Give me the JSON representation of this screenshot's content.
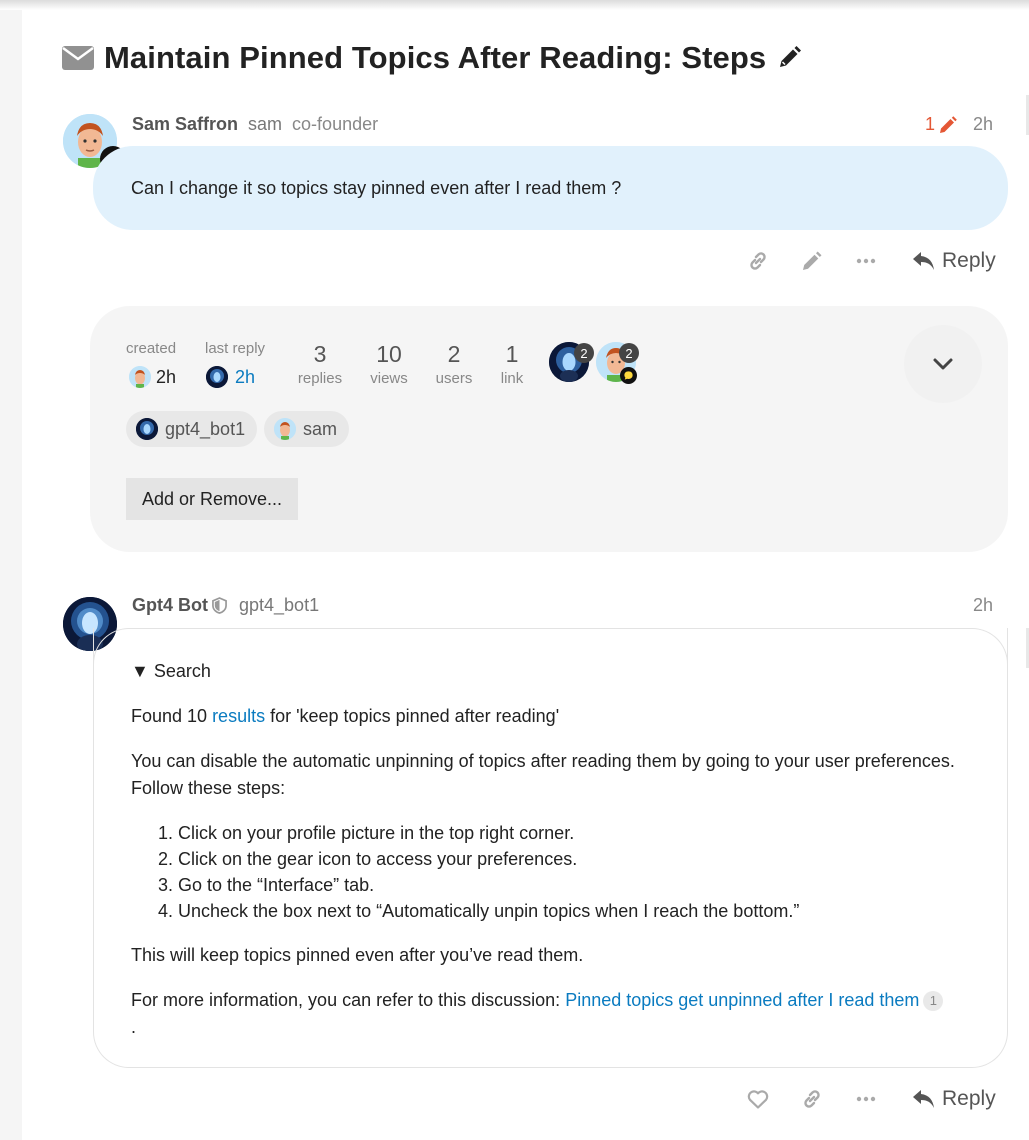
{
  "topic": {
    "title": "Maintain Pinned Topics After Reading: Steps"
  },
  "post1": {
    "full_name": "Sam Saffron",
    "username": "sam",
    "user_title": "co-founder",
    "edit_count": "1",
    "age": "2h",
    "body": "Can I change it so topics stay pinned even after I read them ?",
    "reply_label": "Reply"
  },
  "summary": {
    "created_label": "created",
    "created_value": "2h",
    "last_reply_label": "last reply",
    "last_reply_value": "2h",
    "stats": [
      {
        "num": "3",
        "label": "replies"
      },
      {
        "num": "10",
        "label": "views"
      },
      {
        "num": "2",
        "label": "users"
      },
      {
        "num": "1",
        "label": "link"
      }
    ],
    "participants": [
      {
        "user": "gpt4_bot1",
        "count": "2"
      },
      {
        "user": "sam",
        "count": "2"
      }
    ],
    "chips": [
      "gpt4_bot1",
      "sam"
    ],
    "add_remove_label": "Add or Remove..."
  },
  "post2": {
    "full_name": "Gpt4 Bot",
    "username": "gpt4_bot1",
    "age": "2h",
    "details_summary": "▼ Search",
    "found_prefix": "Found 10 ",
    "found_link": "results",
    "found_suffix": " for 'keep topics pinned after reading'",
    "para1": "You can disable the automatic unpinning of topics after reading them by going to your user preferences. Follow these steps:",
    "steps": [
      "Click on your profile picture in the top right corner.",
      "Click on the gear icon to access your preferences.",
      "Go to the “Interface” tab.",
      "Uncheck the box next to “Automatically unpin topics when I reach the bottom.”"
    ],
    "para2": "This will keep topics pinned even after you’ve read them.",
    "more_prefix": "For more information, you can refer to this discussion: ",
    "more_link": "Pinned topics get unpinned after I read them",
    "more_link_count": "1",
    "trailing": ".",
    "reply_label": "Reply"
  },
  "colors": {
    "accent_link": "#0a7bc0",
    "edit_orange": "#e45735",
    "bubble_bg": "#e1f1fc"
  },
  "icons": [
    "envelope-icon",
    "pencil-icon",
    "link-icon",
    "ellipsis-icon",
    "reply-icon",
    "heart-icon",
    "shield-icon",
    "chevron-down-icon"
  ]
}
